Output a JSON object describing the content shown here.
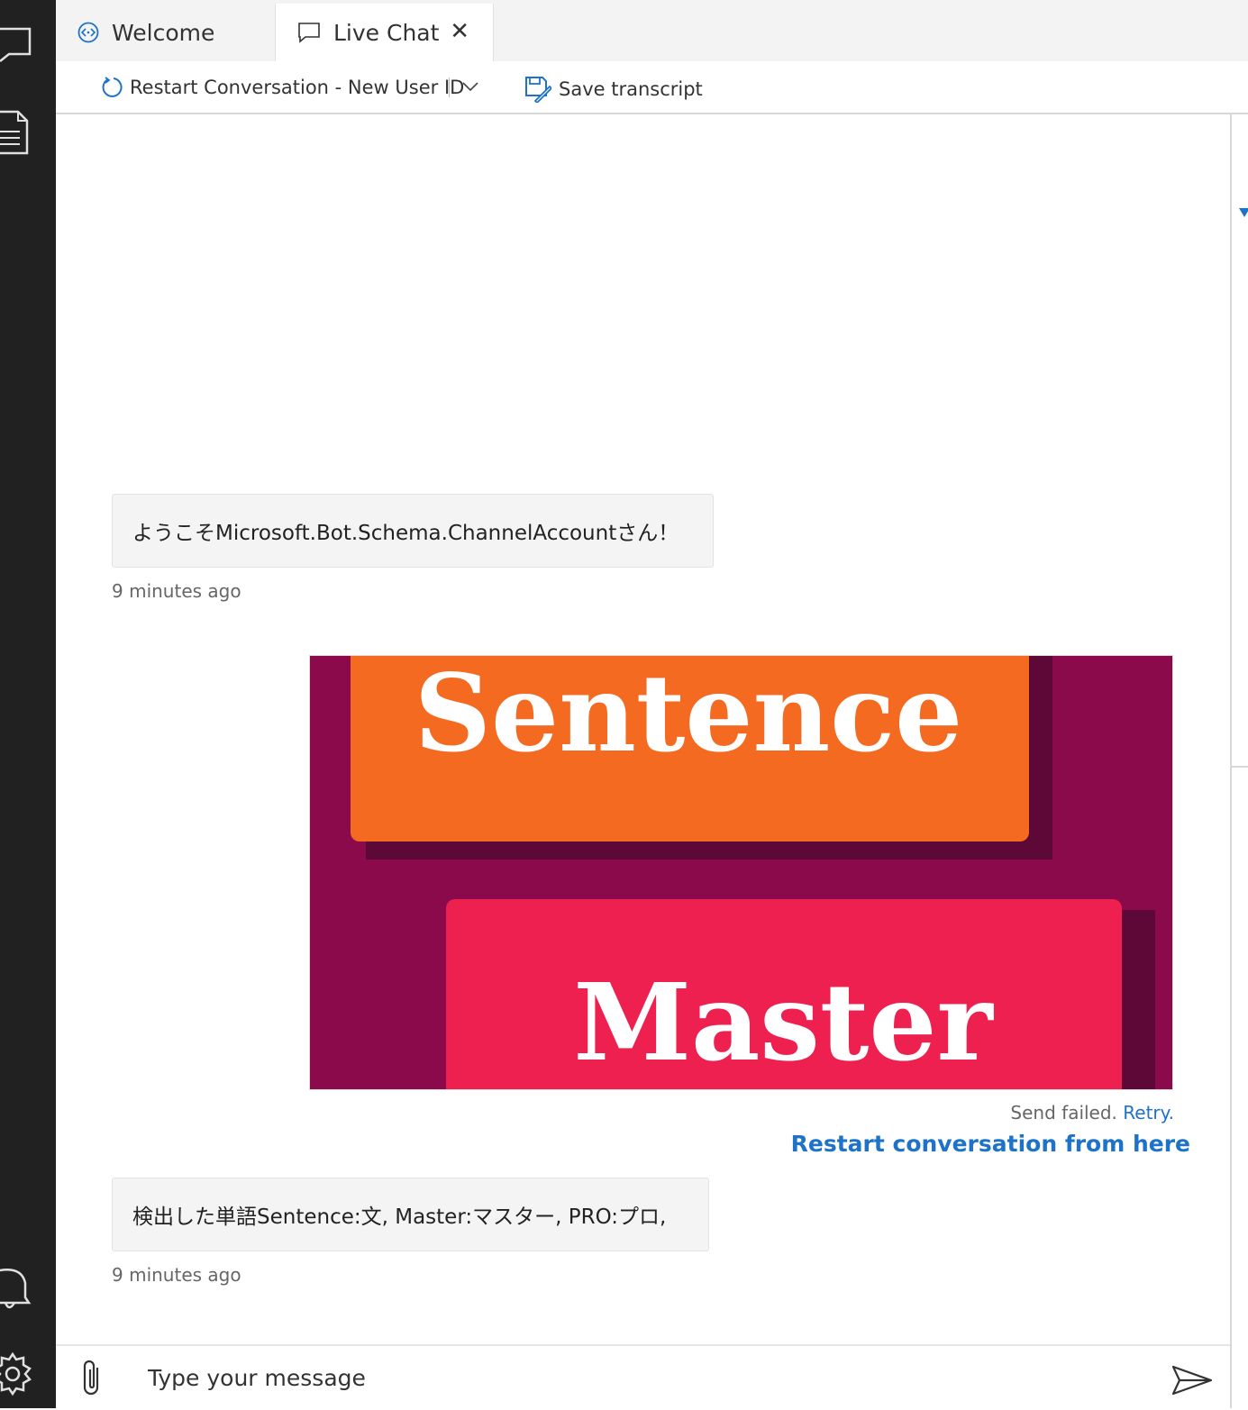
{
  "tabs": {
    "welcome_label": "Welcome",
    "live_chat_label": "Live Chat",
    "close_glyph": "✕"
  },
  "toolbar": {
    "restart_label": "Restart Conversation - New User ID",
    "save_label": "Save transcript"
  },
  "messages": [
    {
      "from": "bot",
      "text": "ようこそMicrosoft.Bot.Schema.ChannelAccountさん！",
      "timestamp": "9 minutes ago"
    },
    {
      "from": "user",
      "type": "image",
      "image_text_top": "Sentence",
      "image_text_bottom": "Master",
      "status_text": "Send failed.",
      "retry_label": "Retry.",
      "restart_link": "Restart conversation from here"
    },
    {
      "from": "bot",
      "text": "検出した単語Sentence:文, Master:マスター, PRO:プロ,",
      "timestamp": "9 minutes ago"
    }
  ],
  "composer": {
    "placeholder": "Type your message"
  },
  "colors": {
    "accent": "#1e73c8",
    "activity_bar": "#212121",
    "image_bg": "#8a0a4b",
    "image_top": "#f46a21",
    "image_bottom": "#ee2050"
  },
  "icons": [
    "chat-icon",
    "document-icon",
    "bell-icon",
    "gear-icon",
    "bot-icon",
    "chat-bubble-icon",
    "close-icon",
    "restart-icon",
    "chevron-down-icon",
    "save-icon",
    "paperclip-icon",
    "send-icon"
  ]
}
